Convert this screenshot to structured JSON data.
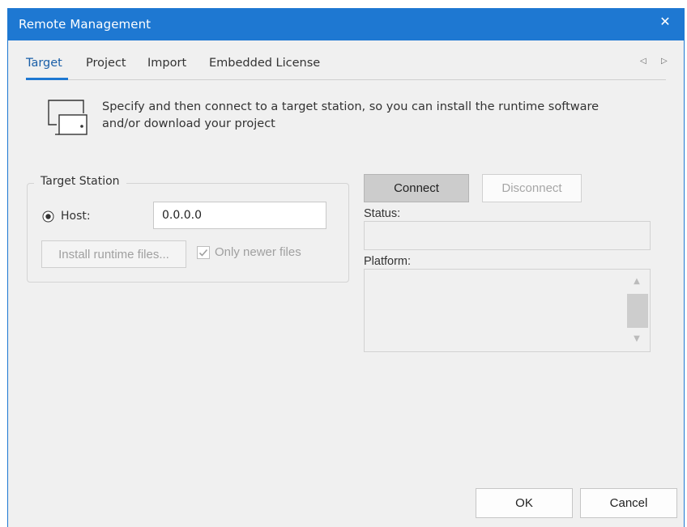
{
  "window": {
    "title": "Remote Management",
    "close_icon": "close-icon"
  },
  "tabs": [
    {
      "label": "Target",
      "active": true
    },
    {
      "label": "Project",
      "active": false
    },
    {
      "label": "Import",
      "active": false
    },
    {
      "label": "Embedded License",
      "active": false
    }
  ],
  "tab_nav": {
    "prev_icon": "chevron-left-icon",
    "next_icon": "chevron-right-icon"
  },
  "description": {
    "icon": "target-station-icon",
    "text": "Specify and then connect to a target station, so you can install the runtime software and/or download your project"
  },
  "target_station": {
    "title": "Target Station",
    "host_label": "Host:",
    "host_selected": true,
    "host_value": "0.0.0.0",
    "install_button": "Install runtime files...",
    "install_enabled": false,
    "only_newer_label": "Only newer files",
    "only_newer_checked": true,
    "only_newer_enabled": false
  },
  "connection": {
    "connect_button": "Connect",
    "disconnect_button": "Disconnect",
    "disconnect_enabled": false,
    "status_label": "Status:",
    "status_value": "",
    "platform_label": "Platform:",
    "platform_value": ""
  },
  "footer": {
    "ok_button": "OK",
    "cancel_button": "Cancel"
  },
  "colors": {
    "accent": "#1e78d2",
    "background": "#f0f0f0",
    "disabled_text": "#a0a0a0"
  }
}
